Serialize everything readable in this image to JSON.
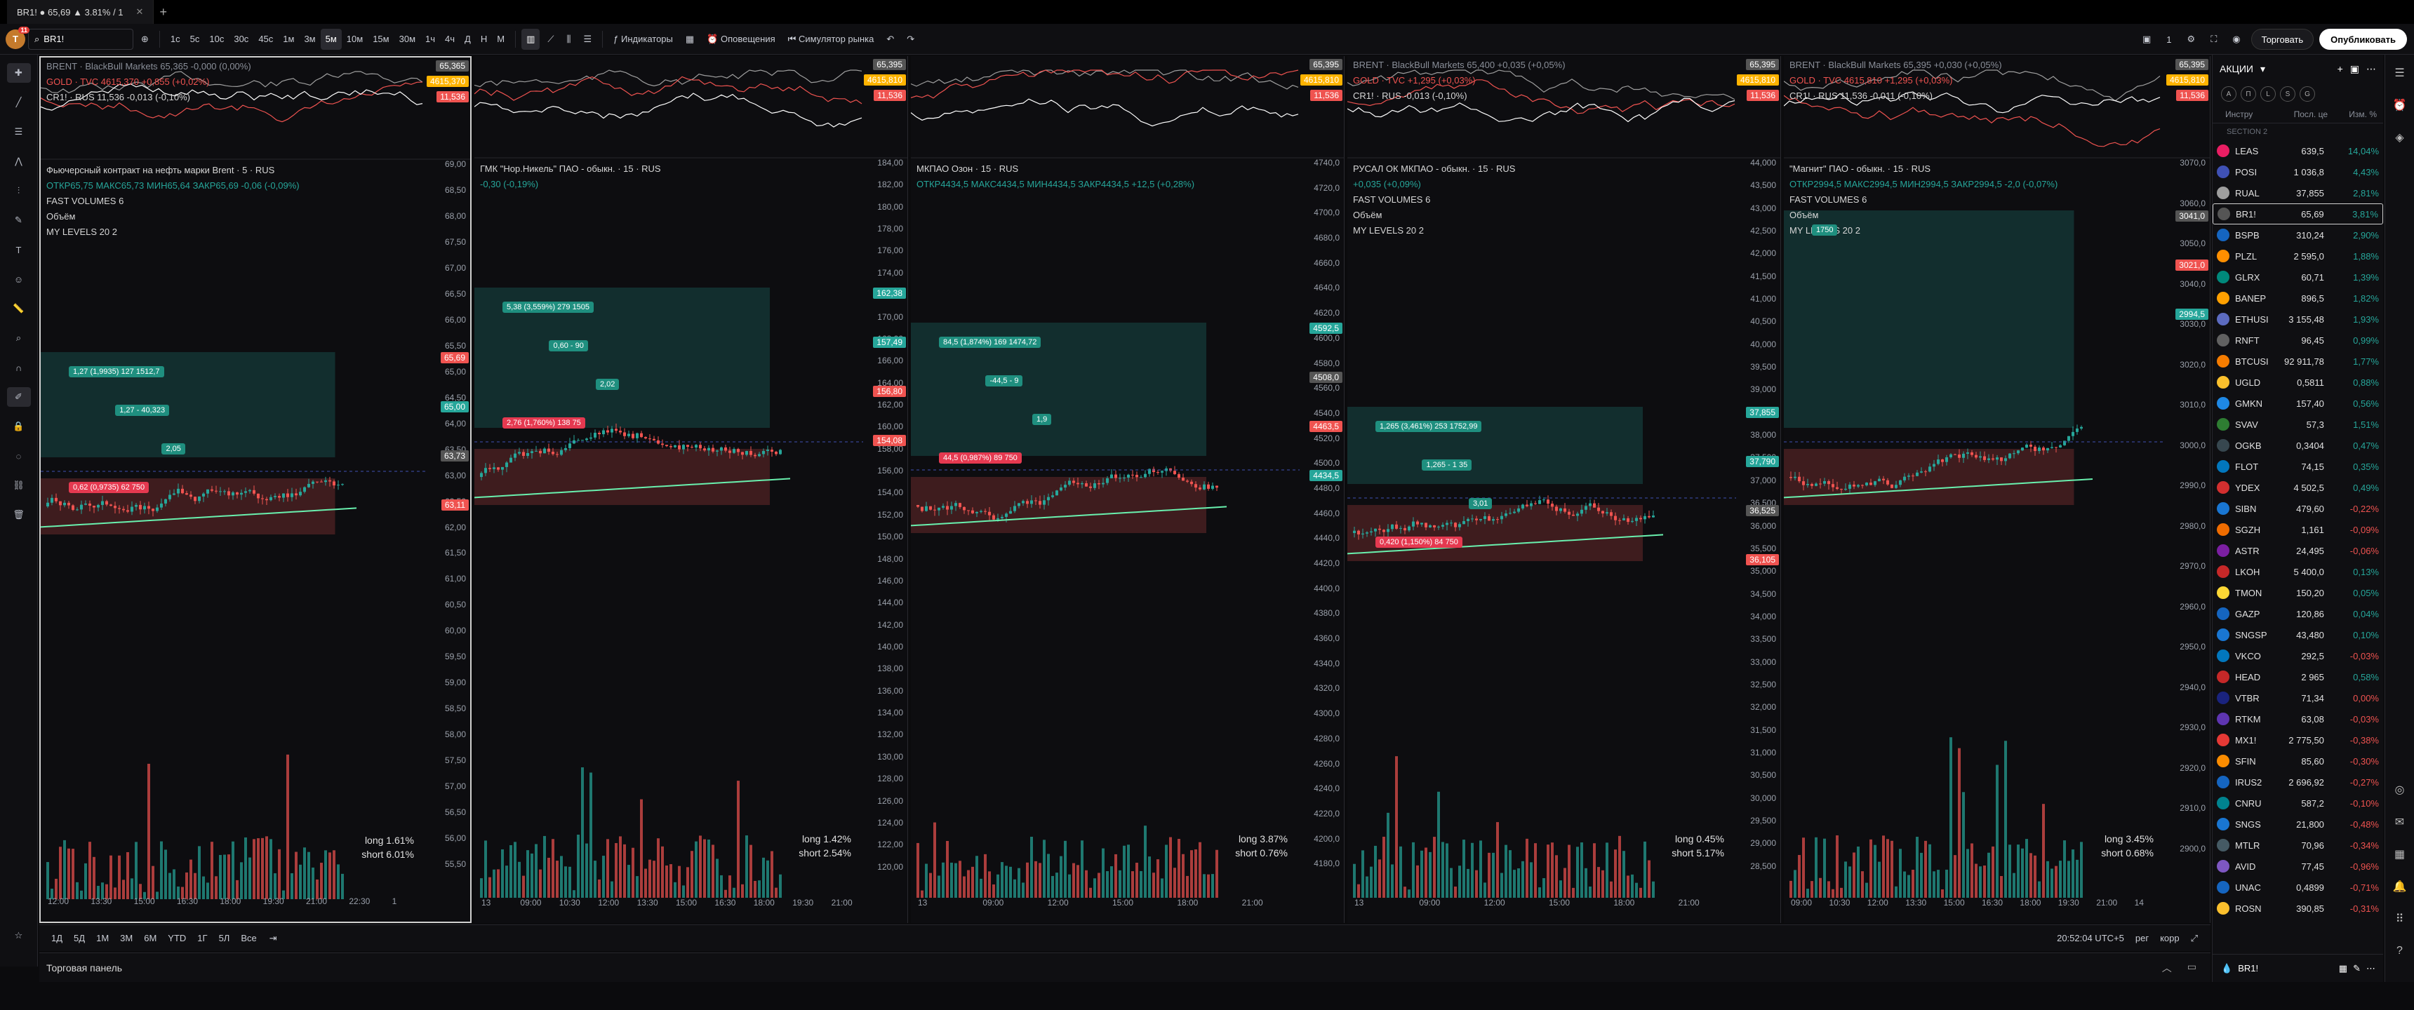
{
  "titlebar": {
    "tab_title": "BR1! ● 65,69 ▲ 3.81% / 1",
    "new_tab": "+"
  },
  "toolbar": {
    "avatar": "T",
    "avatar_badge": "11",
    "symbol": "BR1!",
    "intervals": [
      "1с",
      "5с",
      "10с",
      "30с",
      "45с",
      "1м",
      "3м",
      "5м",
      "10м",
      "15м",
      "30м",
      "1ч",
      "4ч",
      "Д",
      "Н",
      "М"
    ],
    "active_interval": "5м",
    "indicators": "Индикаторы",
    "alerts": "Оповещения",
    "replay": "Симулятор рынка",
    "trade": "Торговать",
    "publish": "Опубликовать",
    "layout_count": "1"
  },
  "colors": {
    "up": "#26a69a",
    "down": "#ef5350",
    "bg": "#0d0d10",
    "ma": "#69f0ae"
  },
  "panes": [
    {
      "id": "p1",
      "title": "Фьючерсный контракт на нефть марки Brent · 5 · RUS",
      "ohlc": "ОТКР65,75 МАКС65,73 МИН65,64 ЗАКР65,69 -0,06 (-0,09%)",
      "mini": [
        "BRENT · BlackBull Markets 65,365 -0,000 (0,00%)",
        "GOLD · TVC 4615,370 +0,855 (+0,02%)",
        "CR1! · RUS 11,536 -0,013 (-0,10%)"
      ],
      "ind": [
        "FAST VOLUMES 6",
        "Объём",
        "MY LEVELS 20 2"
      ],
      "long": "long  1.61%",
      "short": "short  6.01%",
      "yticks": [
        "69,00",
        "68,50",
        "68,00",
        "67,50",
        "67,00",
        "66,50",
        "66,00",
        "65,50",
        "65,00",
        "64,50",
        "64,00",
        "63,50",
        "63,00",
        "62,50",
        "62,00",
        "61,50",
        "61,00",
        "60,50",
        "60,00",
        "59,50",
        "59,00",
        "58,50",
        "58,00",
        "57,50",
        "57,00",
        "56,50",
        "56,00",
        "55,50"
      ],
      "xticks": [
        "12:00",
        "13:30",
        "15:00",
        "16:30",
        "18:00",
        "19:30",
        "21:00",
        "22:30",
        "1"
      ],
      "tags": [
        {
          "v": "65,69",
          "c": "#ef5350"
        },
        {
          "v": "65,00",
          "c": "#26a69a"
        },
        {
          "v": "63,73",
          "c": "#555"
        },
        {
          "v": "63,11",
          "c": "#ef5350"
        }
      ],
      "mtags": [
        "65,365",
        "4615,370",
        "11,536"
      ],
      "boxes": [
        "1,27 (1,9935) 127 1512,7",
        "1,27 - 40,323",
        "2,05",
        "0,62 (0,9735) 62 750"
      ]
    },
    {
      "id": "p2",
      "title": "ГМК \"Нор.Никель\" ПАО - обыкн. · 15 · RUS",
      "ohlc": "-0,30 (-0,19%)",
      "mini": [],
      "ind": [],
      "long": "long  1.42%",
      "short": "short  2.54%",
      "yticks": [
        "184,00",
        "182,00",
        "180,00",
        "178,00",
        "176,00",
        "174,00",
        "172,00",
        "170,00",
        "168,00",
        "166,00",
        "164,00",
        "162,00",
        "160,00",
        "158,00",
        "156,00",
        "154,00",
        "152,00",
        "150,00",
        "148,00",
        "146,00",
        "144,00",
        "142,00",
        "140,00",
        "138,00",
        "136,00",
        "134,00",
        "132,00",
        "130,00",
        "128,00",
        "126,00",
        "124,00",
        "122,00",
        "120,00"
      ],
      "xticks": [
        "13",
        "09:00",
        "10:30",
        "12:00",
        "13:30",
        "15:00",
        "16:30",
        "18:00",
        "19:30",
        "21:00"
      ],
      "tags": [
        {
          "v": "162,38",
          "c": "#26a69a"
        },
        {
          "v": "157,49",
          "c": "#26a69a"
        },
        {
          "v": "156,80",
          "c": "#ef5350"
        },
        {
          "v": "154,08",
          "c": "#ef5350"
        }
      ],
      "mtags": [
        "65,395",
        "4615,810",
        "11,536"
      ],
      "boxes": [
        "5,38 (3,559%) 279 1505",
        "0,60 - 90",
        "2,02",
        "2,76 (1,760%) 138 75"
      ]
    },
    {
      "id": "p3",
      "title": "МКПАО Озон · 15 · RUS",
      "ohlc": "ОТКР4434,5 МАКС4434,5 МИН4434,5 ЗАКР4434,5 +12,5 (+0,28%)",
      "mini": [],
      "ind": [],
      "long": "long  3.87%",
      "short": "short  0.76%",
      "yticks": [
        "4740,0",
        "4720,0",
        "4700,0",
        "4680,0",
        "4660,0",
        "4640,0",
        "4620,0",
        "4600,0",
        "4580,0",
        "4560,0",
        "4540,0",
        "4520,0",
        "4500,0",
        "4480,0",
        "4460,0",
        "4440,0",
        "4420,0",
        "4400,0",
        "4380,0",
        "4360,0",
        "4340,0",
        "4320,0",
        "4300,0",
        "4280,0",
        "4260,0",
        "4240,0",
        "4220,0",
        "4200,0",
        "4180,0"
      ],
      "xticks": [
        "13",
        "09:00",
        "12:00",
        "15:00",
        "18:00",
        "21:00"
      ],
      "tags": [
        {
          "v": "4592,5",
          "c": "#26a69a"
        },
        {
          "v": "4508,0",
          "c": "#555"
        },
        {
          "v": "4463,5",
          "c": "#ef5350"
        },
        {
          "v": "4434,5",
          "c": "#26a69a"
        }
      ],
      "mtags": [
        "65,395",
        "4615,810",
        "11,536"
      ],
      "boxes": [
        "84,5 (1,874%) 169 1474,72",
        "-44,5 - 9",
        "1,9",
        "44,5 (0,987%) 89 750"
      ]
    },
    {
      "id": "p4",
      "title": "РУСАЛ ОК МКПАО - обыкн. · 15 · RUS",
      "ohlc": "+0,035 (+0,09%)",
      "mini": [
        "BRENT · BlackBull Markets 65,400 +0,035 (+0,05%)",
        "GOLD · TVC +1,295 (+0,03%)",
        "CR1! · RUS -0,013 (-0,10%)"
      ],
      "ind": [
        "FAST VOLUMES 6",
        "Объём",
        "MY LEVELS 20 2"
      ],
      "long": "long  0.45%",
      "short": "short  5.17%",
      "yticks": [
        "44,000",
        "43,500",
        "43,000",
        "42,500",
        "42,000",
        "41,500",
        "41,000",
        "40,500",
        "40,000",
        "39,500",
        "39,000",
        "38,500",
        "38,000",
        "37,500",
        "37,000",
        "36,500",
        "36,000",
        "35,500",
        "35,000",
        "34,500",
        "34,000",
        "33,500",
        "33,000",
        "32,500",
        "32,000",
        "31,500",
        "31,000",
        "30,500",
        "30,000",
        "29,500",
        "29,000",
        "28,500"
      ],
      "xticks": [
        "13",
        "09:00",
        "12:00",
        "15:00",
        "18:00",
        "21:00"
      ],
      "tags": [
        {
          "v": "37,855",
          "c": "#26a69a"
        },
        {
          "v": "37,790",
          "c": "#26a69a"
        },
        {
          "v": "36,525",
          "c": "#555"
        },
        {
          "v": "36,105",
          "c": "#ef5350"
        }
      ],
      "mtags": [
        "65,395",
        "4615,810",
        "11,536"
      ],
      "boxes": [
        "1,265 (3,461%) 253 1752,99",
        "1,265 - 1 35",
        "3,01",
        "0,420 (1,150%) 84 750"
      ]
    },
    {
      "id": "p5",
      "title": "\"Магнит\" ПАО - обыкн. · 15 · RUS",
      "ohlc": "ОТКР2994,5 МАКС2994,5 МИН2994,5 ЗАКР2994,5 -2,0 (-0,07%)",
      "mini": [
        "BRENT · BlackBull Markets 65,395 +0,030 (+0,05%)",
        "GOLD · TVC 4615,810 +1,295 (+0,03%)",
        "CR1! · RUS 11,536 -0,011 (-0,10%)"
      ],
      "ind": [
        "FAST VOLUMES 6",
        "Объём",
        "MY LEVELS 20 2"
      ],
      "long": "long  3.45%",
      "short": "short  0.68%",
      "yticks": [
        "3070,0",
        "3060,0",
        "3050,0",
        "3040,0",
        "3030,0",
        "3020,0",
        "3010,0",
        "3000,0",
        "2990,0",
        "2980,0",
        "2970,0",
        "2960,0",
        "2950,0",
        "2940,0",
        "2930,0",
        "2920,0",
        "2910,0",
        "2900,0"
      ],
      "xticks": [
        "09:00",
        "10:30",
        "12:00",
        "13:30",
        "15:00",
        "16:30",
        "18:00",
        "19:30",
        "21:00",
        "14"
      ],
      "tags": [
        {
          "v": "3041,0",
          "c": "#555"
        },
        {
          "v": "3021,0",
          "c": "#ef5350"
        },
        {
          "v": "2994,5",
          "c": "#26a69a"
        }
      ],
      "mtags": [
        "65,395",
        "4615,810",
        "11,536"
      ],
      "boxes": [
        "1750"
      ]
    }
  ],
  "bottombar": {
    "ranges": [
      "1Д",
      "5Д",
      "1М",
      "3М",
      "6М",
      "YTD",
      "1Г",
      "5Л",
      "Все"
    ],
    "clock": "20:52:04 UTC+5",
    "per": "рег",
    "corr": "корр"
  },
  "tradepanel": {
    "label": "Торговая панель"
  },
  "watchlist": {
    "title": "АКЦИИ",
    "filters": [
      "A",
      "П",
      "L",
      "S",
      "G"
    ],
    "cols": [
      "Инстру",
      "Посл. це",
      "Изм. %"
    ],
    "section": "SECTION 2",
    "rows": [
      [
        "LEAS",
        "639,5",
        "14,04%",
        "#e91e63",
        1
      ],
      [
        "POSI",
        "1 036,8",
        "4,43%",
        "#3f51b5",
        1
      ],
      [
        "RUAL",
        "37,855",
        "2,81%",
        "#9e9e9e",
        1
      ],
      [
        "BR1!",
        "65,69",
        "3,81%",
        "#555",
        1
      ],
      [
        "BSPB",
        "310,24",
        "2,90%",
        "#1565c0",
        1
      ],
      [
        "PLZL",
        "2 595,0",
        "1,88%",
        "#ff8f00",
        1
      ],
      [
        "GLRX",
        "60,71",
        "1,39%",
        "#00897b",
        1
      ],
      [
        "BANEP",
        "896,5",
        "1,82%",
        "#ffa000",
        1
      ],
      [
        "ETHUSI",
        "3 155,48",
        "1,93%",
        "#5c6bc0",
        1
      ],
      [
        "RNFT",
        "96,45",
        "0,99%",
        "#616161",
        1
      ],
      [
        "BTCUSI",
        "92 911,78",
        "1,77%",
        "#f57c00",
        1
      ],
      [
        "UGLD",
        "0,5811",
        "0,88%",
        "#fbc02d",
        1
      ],
      [
        "GMKN",
        "157,40",
        "0,56%",
        "#1e88e5",
        1
      ],
      [
        "SVAV",
        "57,3",
        "1,51%",
        "#2e7d32",
        1
      ],
      [
        "OGKB",
        "0,3404",
        "0,47%",
        "#37474f",
        1
      ],
      [
        "FLOT",
        "74,15",
        "0,35%",
        "#0277bd",
        1
      ],
      [
        "YDEX",
        "4 502,5",
        "0,49%",
        "#d32f2f",
        1
      ],
      [
        "SIBN",
        "479,60",
        "-0,22%",
        "#1976d2",
        0
      ],
      [
        "SGZH",
        "1,161",
        "-0,09%",
        "#ef6c00",
        0
      ],
      [
        "ASTR",
        "24,495",
        "-0,06%",
        "#7b1fa2",
        0
      ],
      [
        "LKOH",
        "5 400,0",
        "0,13%",
        "#c62828",
        1
      ],
      [
        "TMON",
        "150,20",
        "0,05%",
        "#fdd835",
        1
      ],
      [
        "GAZP",
        "120,86",
        "0,04%",
        "#1565c0",
        1
      ],
      [
        "SNGSP",
        "43,480",
        "0,10%",
        "#1976d2",
        1
      ],
      [
        "VKCO",
        "292,5",
        "-0,03%",
        "#0277bd",
        0
      ],
      [
        "HEAD",
        "2 965",
        "0,58%",
        "#c62828",
        1
      ],
      [
        "VTBR",
        "71,34",
        "0,00%",
        "#1a237e",
        0
      ],
      [
        "RTKM",
        "63,08",
        "-0,03%",
        "#5e35b1",
        0
      ],
      [
        "MX1!",
        "2 775,50",
        "-0,38%",
        "#e53935",
        0
      ],
      [
        "SFIN",
        "85,60",
        "-0,30%",
        "#fb8c00",
        0
      ],
      [
        "IRUS2",
        "2 696,92",
        "-0,27%",
        "#1565c0",
        0
      ],
      [
        "CNRU",
        "587,2",
        "-0,10%",
        "#00838f",
        0
      ],
      [
        "SNGS",
        "21,800",
        "-0,48%",
        "#1976d2",
        0
      ],
      [
        "MTLR",
        "70,96",
        "-0,34%",
        "#455a64",
        0
      ],
      [
        "AVID",
        "77,45",
        "-0,96%",
        "#7e57c2",
        0
      ],
      [
        "UNAC",
        "0,4899",
        "-0,71%",
        "#1565c0",
        0
      ],
      [
        "ROSN",
        "390,85",
        "-0,31%",
        "#fbc02d",
        0
      ]
    ],
    "selected": "BR1!",
    "footer": "BR1!"
  }
}
